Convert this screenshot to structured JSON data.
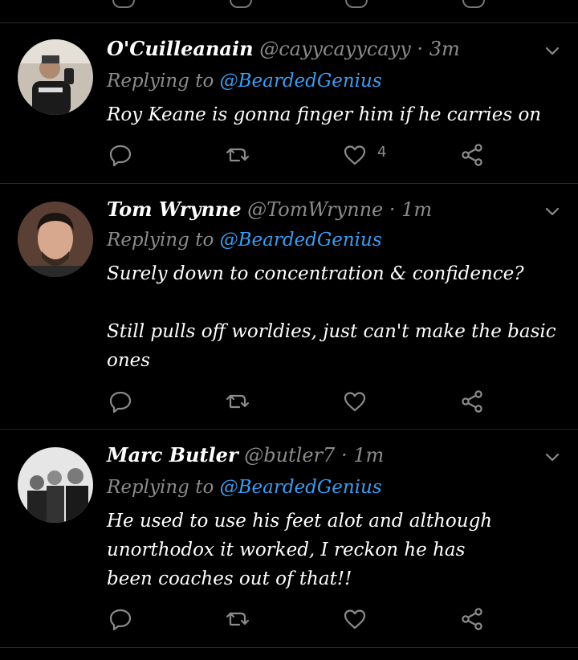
{
  "tweets": [
    {
      "name": "O'Cuilleanain",
      "handle": "@cayycayycayy",
      "time": "3m",
      "replying_label": "Replying to",
      "replying_to": "@BeardedGenius",
      "text_lines": [
        "Roy Keane is gonna finger him if he carries on"
      ],
      "likes": "4",
      "avatar": "avatar-person-selfie"
    },
    {
      "name": "Tom Wrynne",
      "handle": "@TomWrynne",
      "time": "1m",
      "replying_label": "Replying to",
      "replying_to": "@BeardedGenius",
      "text_lines": [
        "Surely down to concentration & confidence?",
        "",
        "Still pulls off worldies, just can't make the basic ones"
      ],
      "likes": "",
      "avatar": "avatar-person-portrait"
    },
    {
      "name": "Marc Butler",
      "handle": "@butler7",
      "time": "1m",
      "replying_label": "Replying to",
      "replying_to": "@BeardedGenius",
      "text_lines": [
        "He used to use his feet alot and although unorthodox it worked, I reckon  he has been coaches out of that!!"
      ],
      "likes": "",
      "avatar": "avatar-group-photo"
    }
  ],
  "separator_dot": "·",
  "icons": [
    "reply-icon",
    "retweet-icon",
    "like-icon",
    "share-icon",
    "chevron-down-icon"
  ],
  "colors": {
    "background": "#000000",
    "mention": "#3b9cf0",
    "muted": "#8b8b8b"
  }
}
